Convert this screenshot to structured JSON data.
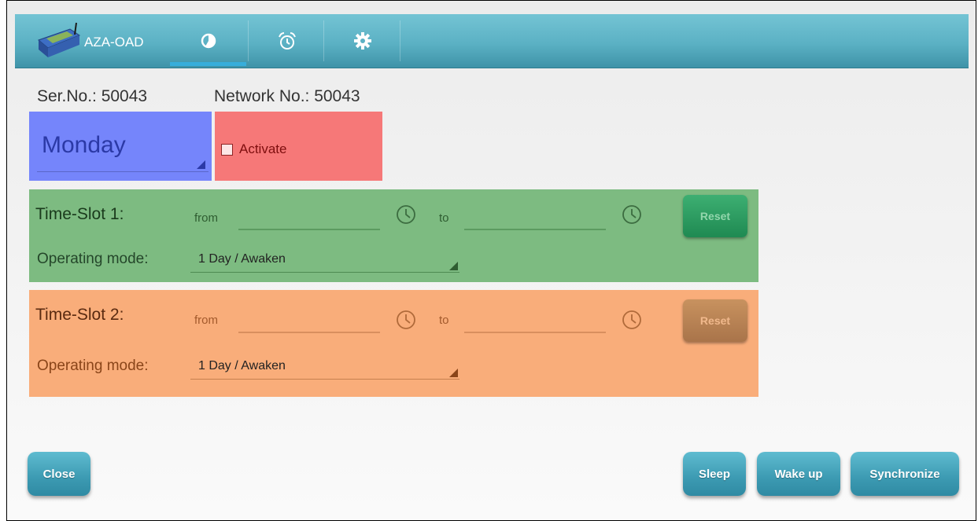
{
  "app": {
    "title": "AZA-OAD"
  },
  "tabs": [
    {
      "icon": "pie-chart-icon",
      "active": true
    },
    {
      "icon": "alarm-clock-icon",
      "active": false
    },
    {
      "icon": "gear-icon",
      "active": false
    }
  ],
  "device": {
    "serial": "Ser.No.: 50043",
    "network": "Network No.: 50043"
  },
  "day": {
    "selected": "Monday"
  },
  "activate": {
    "label": "Activate",
    "checked": false
  },
  "slot1": {
    "title": "Time-Slot 1:",
    "from_label": "from",
    "from_value": "",
    "to_label": "to",
    "to_value": "",
    "reset_label": "Reset",
    "mode_label": "Operating mode:",
    "mode_value": "1 Day / Awaken"
  },
  "slot2": {
    "title": "Time-Slot 2:",
    "from_label": "from",
    "from_value": "",
    "to_label": "to",
    "to_value": "",
    "reset_label": "Reset",
    "mode_label": "Operating mode:",
    "mode_value": "1 Day / Awaken"
  },
  "buttons": {
    "close": "Close",
    "sleep": "Sleep",
    "wake": "Wake up",
    "sync": "Synchronize"
  },
  "colors": {
    "day_block": "#7585fb",
    "activate_block": "#f67878",
    "slot1_block": "#7dbb81",
    "slot2_block": "#f9ad7a",
    "topbar": "#5bb1c4",
    "tab_indicator": "#37aedb"
  }
}
